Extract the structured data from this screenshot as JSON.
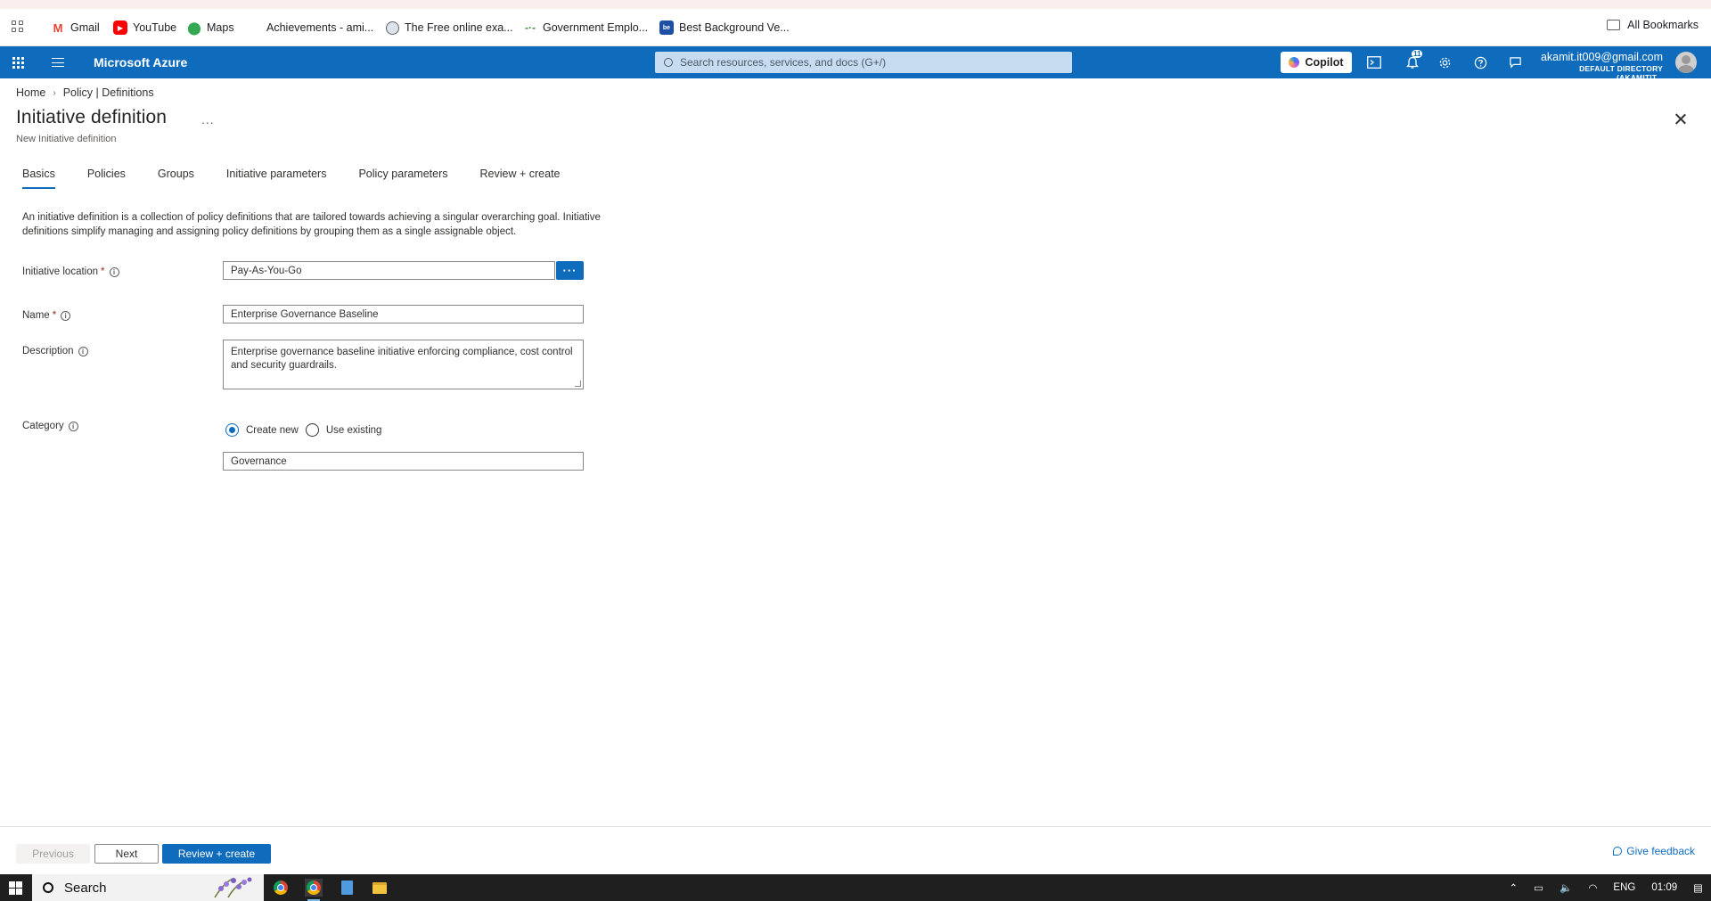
{
  "browser": {
    "bookmarks": [
      {
        "label": "Gmail",
        "icon": "gmail-icon"
      },
      {
        "label": "YouTube",
        "icon": "youtube-icon"
      },
      {
        "label": "Maps",
        "icon": "maps-icon"
      },
      {
        "label": "Achievements - ami...",
        "icon": "microsoft-icon"
      },
      {
        "label": "The Free online exa...",
        "icon": "globe-icon"
      },
      {
        "label": "Government Emplo...",
        "icon": "site-icon"
      },
      {
        "label": "Best Background Ve...",
        "icon": "site-icon"
      }
    ],
    "all_bookmarks": "All Bookmarks"
  },
  "azure": {
    "app_title": "Microsoft Azure",
    "search_placeholder": "Search resources, services, and docs (G+/)",
    "copilot_label": "Copilot",
    "notification_count": "11",
    "account_email": "akamit.it009@gmail.com",
    "account_directory": "DEFAULT DIRECTORY (AKAMITIT..."
  },
  "breadcrumb": {
    "home": "Home",
    "current": "Policy | Definitions"
  },
  "header": {
    "title": "Initiative definition",
    "more": "...",
    "subtitle": "New Initiative definition"
  },
  "tabs": [
    {
      "label": "Basics",
      "active": true
    },
    {
      "label": "Policies"
    },
    {
      "label": "Groups"
    },
    {
      "label": "Initiative parameters"
    },
    {
      "label": "Policy parameters"
    },
    {
      "label": "Review + create"
    }
  ],
  "intro": "An initiative definition is a collection of policy definitions that are tailored towards achieving a singular overarching goal. Initiative definitions simplify managing and assigning policy definitions by grouping them as a single assignable object.",
  "form": {
    "location_label": "Initiative location",
    "location_value": "Pay-As-You-Go",
    "location_browse": "···",
    "name_label": "Name",
    "name_value": "Enterprise Governance Baseline",
    "description_label": "Description",
    "description_value": "Enterprise governance baseline initiative enforcing compliance, cost control and security guardrails.",
    "category_label": "Category",
    "category_option_new": "Create new",
    "category_option_existing": "Use existing",
    "category_value": "Governance",
    "required_mark": "*",
    "info_glyph": "i"
  },
  "footer": {
    "previous": "Previous",
    "next": "Next",
    "review_create": "Review + create",
    "feedback": "Give feedback"
  },
  "taskbar": {
    "search": "Search",
    "language": "ENG",
    "time": "01:09"
  },
  "colors": {
    "azure_blue": "#0f6cbd",
    "required_red": "#a4262c"
  }
}
